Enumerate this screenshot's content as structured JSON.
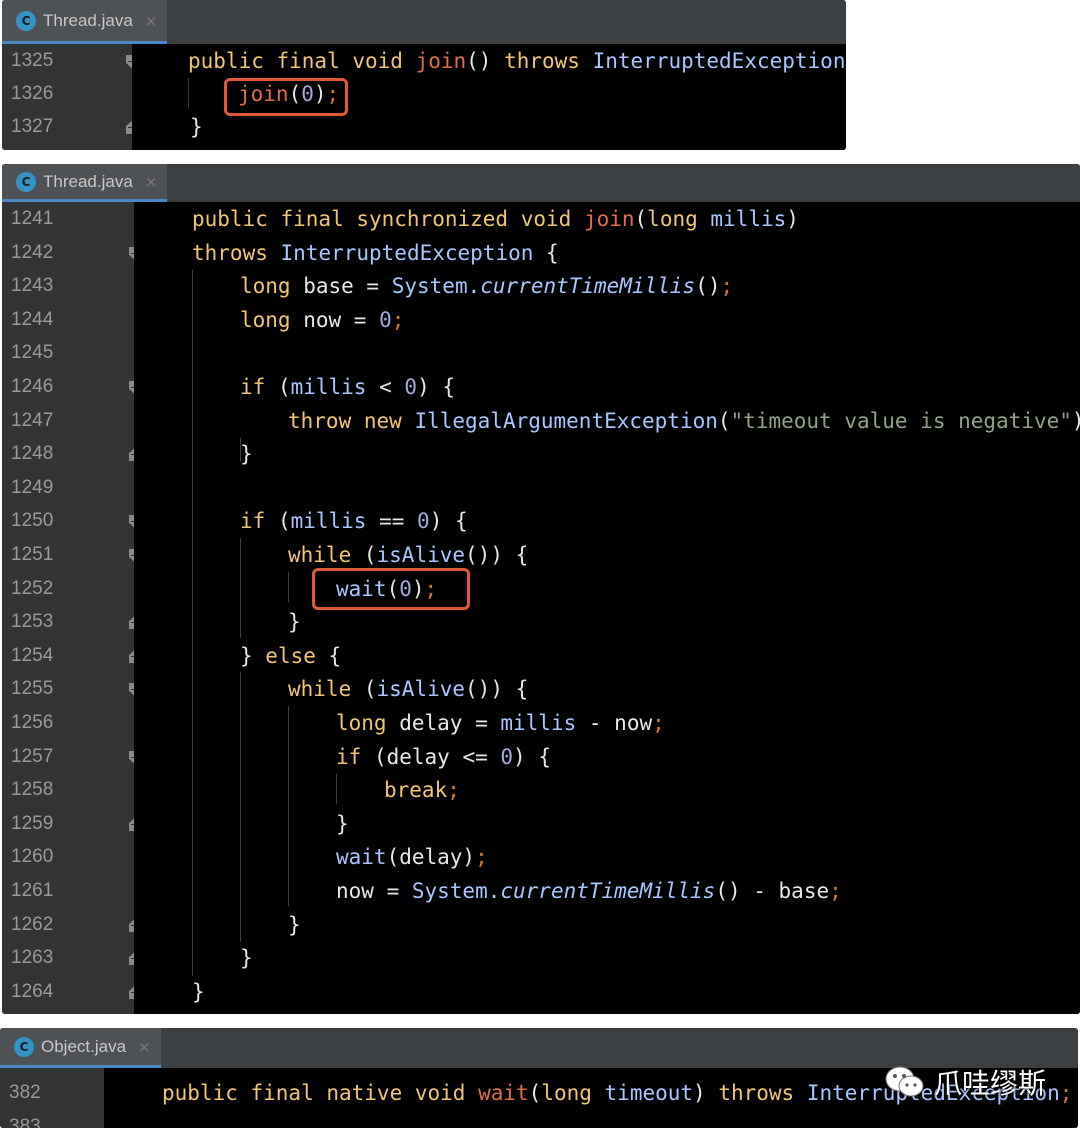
{
  "panels": [
    {
      "tab": {
        "icon": "C",
        "filename": "Thread.java",
        "close": "×"
      },
      "lines": [
        {
          "num": "1325",
          "fold": "open"
        },
        {
          "num": "1326",
          "fold": ""
        },
        {
          "num": "1327",
          "fold": "close"
        }
      ]
    },
    {
      "tab": {
        "icon": "C",
        "filename": "Thread.java",
        "close": "×"
      },
      "lines": [
        {
          "num": "1241",
          "fold": ""
        },
        {
          "num": "1242",
          "fold": "open"
        },
        {
          "num": "1243",
          "fold": ""
        },
        {
          "num": "1244",
          "fold": ""
        },
        {
          "num": "1245",
          "fold": ""
        },
        {
          "num": "1246",
          "fold": "open"
        },
        {
          "num": "1247",
          "fold": ""
        },
        {
          "num": "1248",
          "fold": "close"
        },
        {
          "num": "1249",
          "fold": ""
        },
        {
          "num": "1250",
          "fold": "open"
        },
        {
          "num": "1251",
          "fold": "open"
        },
        {
          "num": "1252",
          "fold": ""
        },
        {
          "num": "1253",
          "fold": "close"
        },
        {
          "num": "1254",
          "fold": "close"
        },
        {
          "num": "1255",
          "fold": "open"
        },
        {
          "num": "1256",
          "fold": ""
        },
        {
          "num": "1257",
          "fold": "open"
        },
        {
          "num": "1258",
          "fold": ""
        },
        {
          "num": "1259",
          "fold": "close"
        },
        {
          "num": "1260",
          "fold": ""
        },
        {
          "num": "1261",
          "fold": ""
        },
        {
          "num": "1262",
          "fold": "close"
        },
        {
          "num": "1263",
          "fold": "close"
        },
        {
          "num": "1264",
          "fold": "close"
        }
      ]
    },
    {
      "tab": {
        "icon": "C",
        "filename": "Object.java",
        "close": "×"
      },
      "lines": [
        {
          "num": "382",
          "fold": ""
        },
        {
          "num": "383",
          "fold": ""
        }
      ]
    }
  ],
  "code": {
    "p1": [
      [
        [
          "k",
          "public final void "
        ],
        [
          "m",
          "join"
        ],
        [
          "v",
          "() "
        ],
        [
          "k",
          "throws "
        ],
        [
          "t",
          "InterruptedException "
        ],
        [
          "v",
          "{"
        ]
      ],
      [
        [
          "m",
          "join"
        ],
        [
          "v",
          "("
        ],
        [
          "n",
          "0"
        ],
        [
          "v",
          ")"
        ],
        [
          "pn",
          ";"
        ]
      ],
      [
        [
          "v",
          "}"
        ]
      ]
    ],
    "p2": [
      [
        [
          "k",
          "public final synchronized void "
        ],
        [
          "m",
          "join"
        ],
        [
          "v",
          "("
        ],
        [
          "k",
          "long "
        ],
        [
          "t",
          "millis"
        ],
        [
          "v",
          ")"
        ]
      ],
      [
        [
          "k",
          "throws "
        ],
        [
          "t",
          "InterruptedException "
        ],
        [
          "v",
          "{"
        ]
      ],
      [
        [
          "k",
          "long "
        ],
        [
          "v",
          "base = "
        ],
        [
          "t",
          "System."
        ],
        [
          "i",
          "currentTimeMillis"
        ],
        [
          "v",
          "()"
        ],
        [
          "pn",
          ";"
        ]
      ],
      [
        [
          "k",
          "long "
        ],
        [
          "v",
          "now = "
        ],
        [
          "n",
          "0"
        ],
        [
          "pn",
          ";"
        ]
      ],
      [],
      [
        [
          "k",
          "if "
        ],
        [
          "v",
          "("
        ],
        [
          "t",
          "millis "
        ],
        [
          "v",
          "< "
        ],
        [
          "n",
          "0"
        ],
        [
          "v",
          ") {"
        ]
      ],
      [
        [
          "k",
          "throw new "
        ],
        [
          "t",
          "IllegalArgumentException"
        ],
        [
          "v",
          "("
        ],
        [
          "s",
          "\"timeout value is negative\""
        ],
        [
          "v",
          ")"
        ],
        [
          "pn",
          ";"
        ]
      ],
      [
        [
          "v",
          "}"
        ]
      ],
      [],
      [
        [
          "k",
          "if "
        ],
        [
          "v",
          "("
        ],
        [
          "t",
          "millis "
        ],
        [
          "v",
          "== "
        ],
        [
          "n",
          "0"
        ],
        [
          "v",
          ") {"
        ]
      ],
      [
        [
          "k",
          "while "
        ],
        [
          "v",
          "("
        ],
        [
          "t",
          "isAlive"
        ],
        [
          "v",
          "()) {"
        ]
      ],
      [
        [
          "t",
          "wait"
        ],
        [
          "v",
          "("
        ],
        [
          "n",
          "0"
        ],
        [
          "v",
          ")"
        ],
        [
          "pn",
          ";"
        ]
      ],
      [
        [
          "v",
          "}"
        ]
      ],
      [
        [
          "v",
          "} "
        ],
        [
          "k",
          "else "
        ],
        [
          "v",
          "{"
        ]
      ],
      [
        [
          "k",
          "while "
        ],
        [
          "v",
          "("
        ],
        [
          "t",
          "isAlive"
        ],
        [
          "v",
          "()) {"
        ]
      ],
      [
        [
          "k",
          "long "
        ],
        [
          "v",
          "delay = "
        ],
        [
          "t",
          "millis "
        ],
        [
          "v",
          "- now"
        ],
        [
          "pn",
          ";"
        ]
      ],
      [
        [
          "k",
          "if "
        ],
        [
          "v",
          "(delay <= "
        ],
        [
          "n",
          "0"
        ],
        [
          "v",
          ") {"
        ]
      ],
      [
        [
          "k",
          "break"
        ],
        [
          "pn",
          ";"
        ]
      ],
      [
        [
          "v",
          "}"
        ]
      ],
      [
        [
          "t",
          "wait"
        ],
        [
          "v",
          "(delay)"
        ],
        [
          "pn",
          ";"
        ]
      ],
      [
        [
          "v",
          "now = "
        ],
        [
          "t",
          "System."
        ],
        [
          "i",
          "currentTimeMillis"
        ],
        [
          "v",
          "() - base"
        ],
        [
          "pn",
          ";"
        ]
      ],
      [
        [
          "v",
          "}"
        ]
      ],
      [
        [
          "v",
          "}"
        ]
      ],
      [
        [
          "v",
          "}"
        ]
      ]
    ],
    "p3": [
      [
        [
          "k",
          "public final native void "
        ],
        [
          "m",
          "wait"
        ],
        [
          "v",
          "("
        ],
        [
          "k",
          "long "
        ],
        [
          "t",
          "timeout"
        ],
        [
          "v",
          ") "
        ],
        [
          "k",
          "throws "
        ],
        [
          "t",
          "InterruptedException"
        ],
        [
          "pn",
          ";"
        ]
      ],
      []
    ]
  },
  "watermark": {
    "text": "爪哇缪斯",
    "icon": "wechat-icon"
  },
  "colors": {
    "highlight": "#e0573a",
    "tab_underline": "#4a88c7"
  }
}
